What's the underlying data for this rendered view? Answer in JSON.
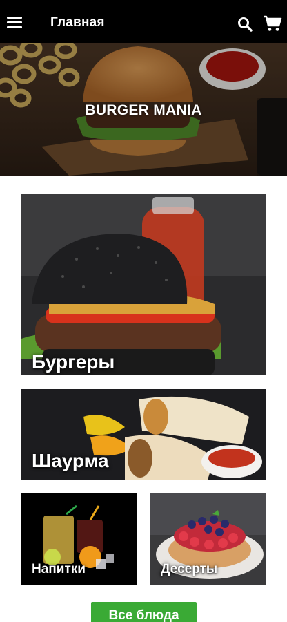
{
  "header": {
    "title": "Главная",
    "menu_icon": "hamburger-menu-icon",
    "search_icon": "search-icon",
    "cart_icon": "shopping-cart-icon",
    "background": "#000000"
  },
  "hero": {
    "title": "BURGER MANIA"
  },
  "categories": [
    {
      "label": "Бургеры"
    },
    {
      "label": "Шаурма"
    },
    {
      "label": "Напитки"
    },
    {
      "label": "Десерты"
    }
  ],
  "all_dishes_button": {
    "label": "Все блюда",
    "color": "#3aaa35"
  }
}
